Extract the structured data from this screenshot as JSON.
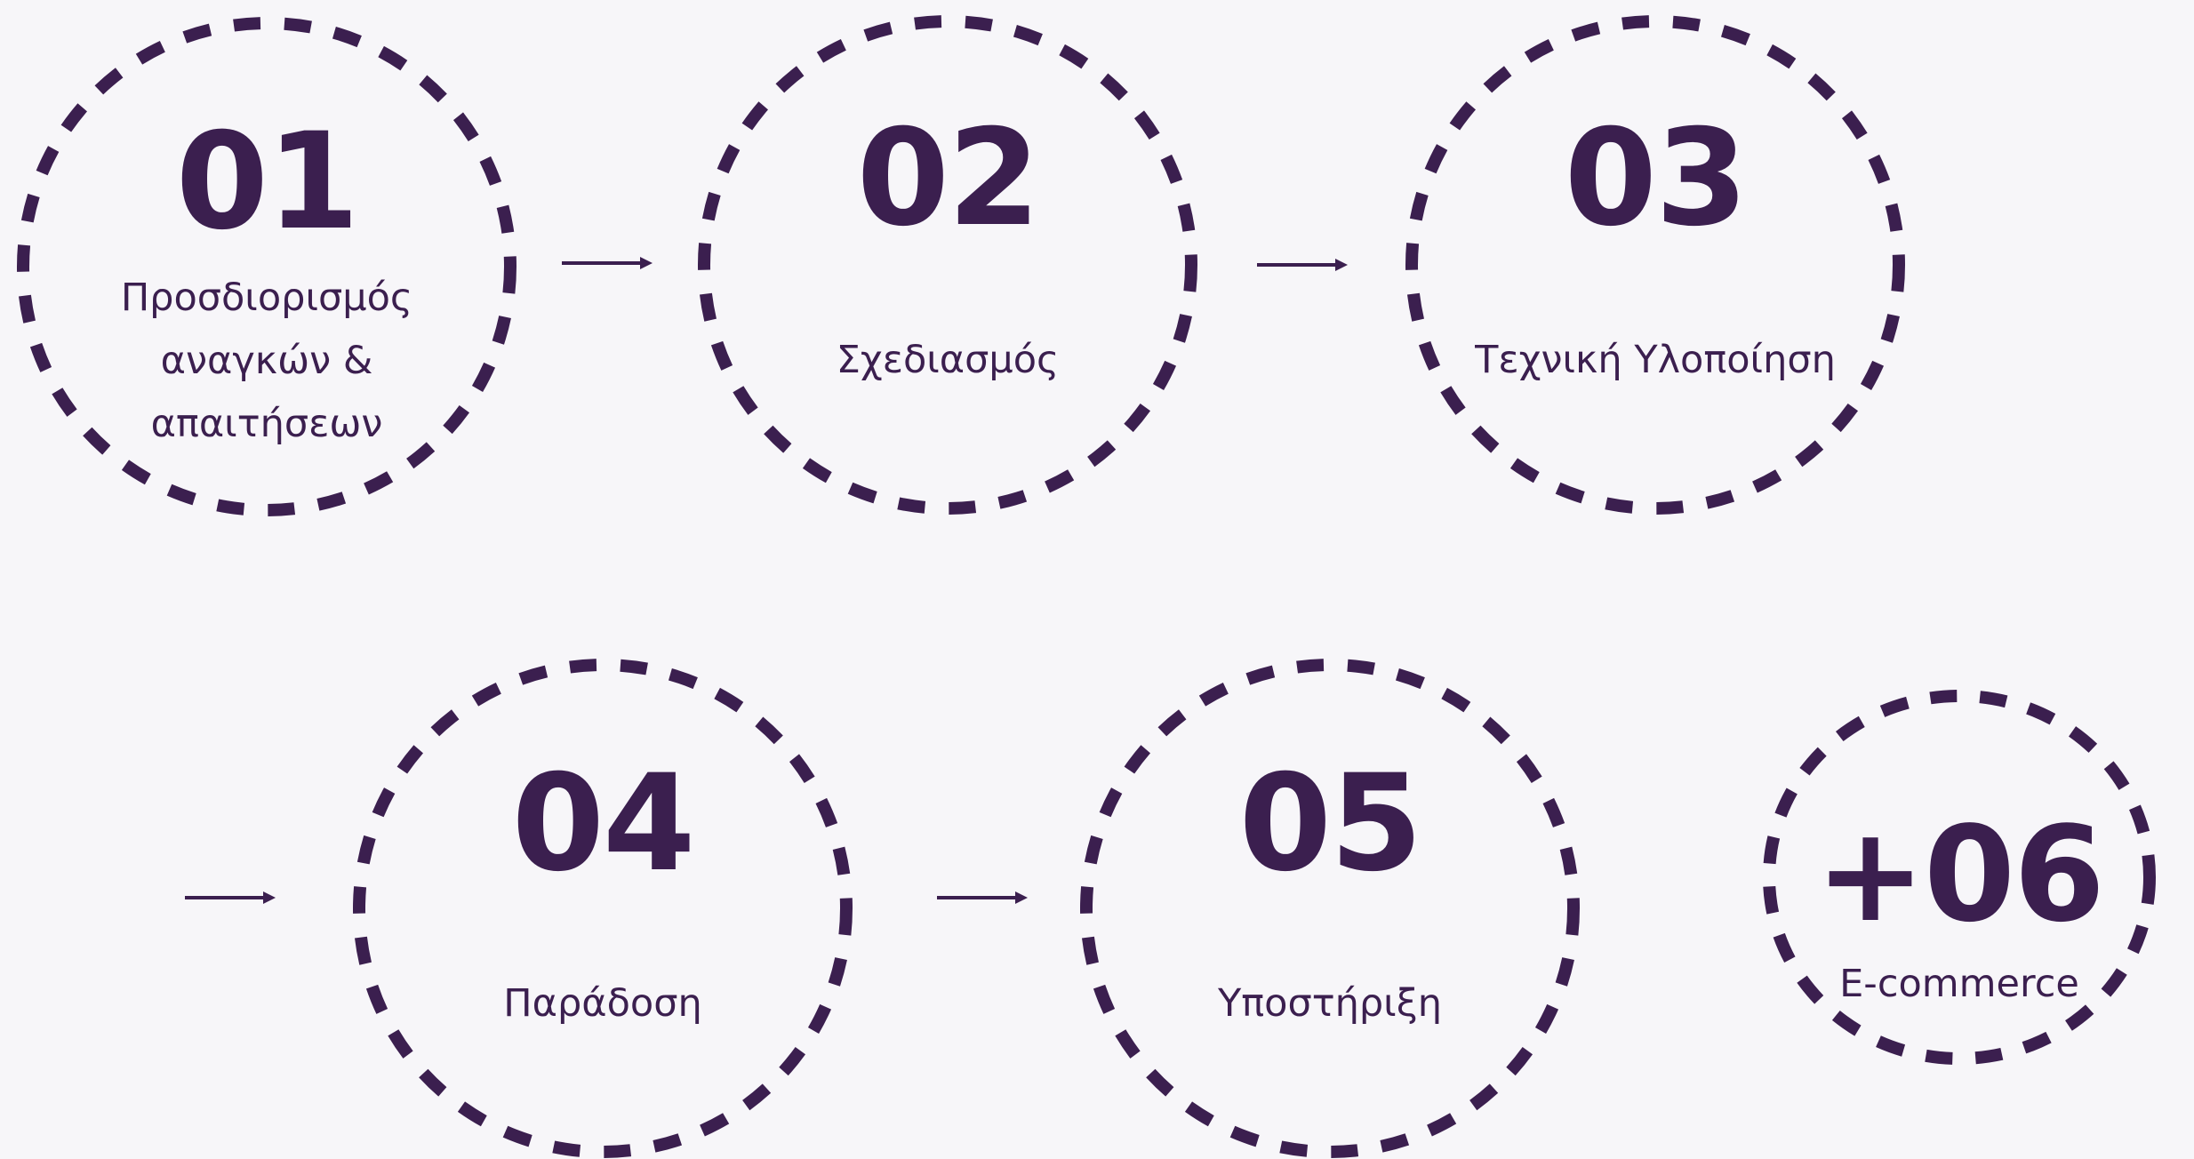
{
  "steps": [
    {
      "number": "01",
      "label": "Προσδιορισμός\nαναγκών &\nαπαιτήσεων"
    },
    {
      "number": "02",
      "label": "Σχεδιασμός"
    },
    {
      "number": "03",
      "label": "Τεχνική Υλοποίηση"
    },
    {
      "number": "04",
      "label": "Παράδοση"
    },
    {
      "number": "05",
      "label": "Υποστήριξη"
    },
    {
      "number": "+06",
      "label": "E-commerce"
    }
  ],
  "colors": {
    "accent": "#3b1f4f",
    "background": "#f7f6f9"
  }
}
